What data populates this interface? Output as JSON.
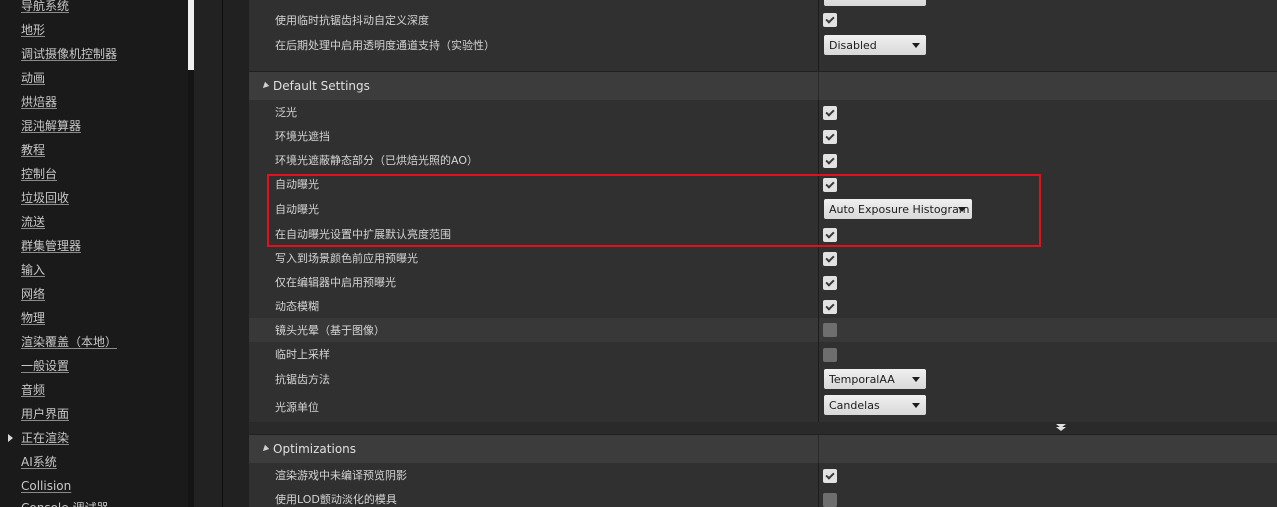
{
  "sidebar": {
    "items": [
      {
        "label": "导航系统"
      },
      {
        "label": "地形"
      },
      {
        "label": "调试摄像机控制器"
      },
      {
        "label": "动画"
      },
      {
        "label": "烘焙器"
      },
      {
        "label": "混沌解算器"
      },
      {
        "label": "教程"
      },
      {
        "label": "控制台"
      },
      {
        "label": "垃圾回收"
      },
      {
        "label": "流送"
      },
      {
        "label": "群集管理器"
      },
      {
        "label": "输入"
      },
      {
        "label": "网络"
      },
      {
        "label": "物理"
      },
      {
        "label": "渲染覆盖（本地）"
      },
      {
        "label": "一般设置"
      },
      {
        "label": "音频"
      },
      {
        "label": "用户界面"
      },
      {
        "label": "正在渲染",
        "selected": true
      },
      {
        "label": "AI系统"
      },
      {
        "label": "Collision"
      },
      {
        "label": "Console 调试器"
      }
    ]
  },
  "top_rows": [
    {
      "label": "使用临时抗锯齿抖动自定义深度",
      "type": "checkbox",
      "checked": true
    },
    {
      "label": "在后期处理中启用透明度通道支持（实验性）",
      "type": "dropdown",
      "value": "Disabled"
    }
  ],
  "sections": {
    "default": {
      "title": "Default Settings",
      "rows": [
        {
          "label": "泛光",
          "type": "checkbox",
          "checked": true
        },
        {
          "label": "环境光遮挡",
          "type": "checkbox",
          "checked": true
        },
        {
          "label": "环境光遮蔽静态部分（已烘焙光照的AO）",
          "type": "checkbox",
          "checked": true
        },
        {
          "label": "自动曝光",
          "type": "checkbox",
          "checked": true
        },
        {
          "label": "自动曝光",
          "type": "dropdown",
          "value": "Auto Exposure Histogram"
        },
        {
          "label": "在自动曝光设置中扩展默认亮度范围",
          "type": "checkbox",
          "checked": true
        },
        {
          "label": "写入到场景颜色前应用预曝光",
          "type": "checkbox",
          "checked": true
        },
        {
          "label": "仅在编辑器中启用预曝光",
          "type": "checkbox",
          "checked": true
        },
        {
          "label": "动态模糊",
          "type": "checkbox",
          "checked": true
        },
        {
          "label": "镜头光晕（基于图像）",
          "type": "checkbox",
          "checked": false
        },
        {
          "label": "临时上采样",
          "type": "checkbox",
          "checked": false
        },
        {
          "label": "抗锯齿方法",
          "type": "dropdown",
          "value": "TemporalAA"
        },
        {
          "label": "光源单位",
          "type": "dropdown",
          "value": "Candelas"
        }
      ]
    },
    "optimizations": {
      "title": "Optimizations",
      "rows": [
        {
          "label": "渲染游戏中未编译预览阴影",
          "type": "checkbox",
          "checked": true
        },
        {
          "label": "使用LOD颤动淡化的模具",
          "type": "checkbox",
          "checked": false
        }
      ]
    }
  },
  "colors": {
    "highlight_box": "#e2101c",
    "panel_bg": "#212121",
    "row_bg": "#303030",
    "row_alt_bg": "#383838",
    "section_header_bg": "#3c3c3c"
  }
}
